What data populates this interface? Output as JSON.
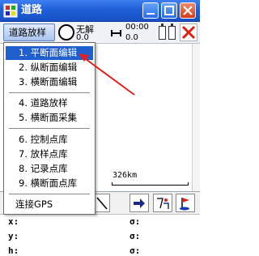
{
  "window": {
    "title": "道路",
    "accent_color": "#1f5fd8",
    "buttons": [
      "ok-icon",
      "minimize-icon",
      "close-icon"
    ]
  },
  "status": {
    "road_button_label": "道路放样",
    "solution_label": "无解",
    "solution_value": "0.0",
    "time_label": "00:00",
    "time_value": "0.0"
  },
  "menu": {
    "items": [
      {
        "label": "1. 平断面编辑"
      },
      {
        "label": "2. 纵断面编辑"
      },
      {
        "label": "3. 横断面编辑"
      },
      {
        "label": "4. 道路放样"
      },
      {
        "label": "5. 横断面采集"
      },
      {
        "label": "6. 控制点库"
      },
      {
        "label": "7. 放样点库"
      },
      {
        "label": "8. 记录点库"
      },
      {
        "label": "9. 横断面点库"
      },
      {
        "label": "连接GPS"
      }
    ],
    "selected_index": 0,
    "selected_color": "#1f5fd0"
  },
  "map": {
    "scale_label": "326km"
  },
  "coords": {
    "x_label": "x:",
    "y_label": "y:",
    "h_label": "h:",
    "sigma_label": "σ:"
  },
  "annotation": {
    "arrow_color": "#e02020"
  }
}
